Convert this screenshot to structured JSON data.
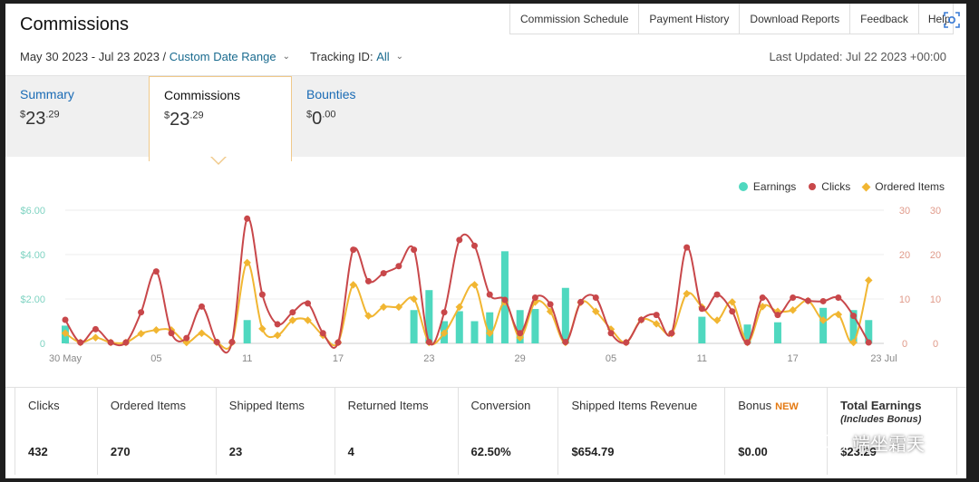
{
  "page": {
    "title": "Commissions",
    "top_tabs": [
      "Commission Schedule",
      "Payment History",
      "Download Reports",
      "Feedback",
      "Help"
    ],
    "date_range": "May 30 2023 - Jul 23 2023 /",
    "date_range_link": "Custom Date Range",
    "tracking_label": "Tracking ID:",
    "tracking_value": "All",
    "last_updated": "Last Updated: Jul 22 2023 +00:00"
  },
  "summary_tabs": [
    {
      "label": "Summary",
      "currency": "$",
      "whole": "23",
      "cents": ".29"
    },
    {
      "label": "Commissions",
      "currency": "$",
      "whole": "23",
      "cents": ".29"
    },
    {
      "label": "Bounties",
      "currency": "$",
      "whole": "0",
      "cents": ".00"
    }
  ],
  "legend": {
    "earnings": "Earnings",
    "clicks": "Clicks",
    "ordered": "Ordered Items"
  },
  "colors": {
    "earnings": "#4fd8bf",
    "clicks": "#c8474a",
    "ordered": "#f1b632",
    "link": "#1a6bb5"
  },
  "chart_data": {
    "type": "line",
    "x": [
      "30 May",
      "31 May",
      "01 Jun",
      "02 Jun",
      "03 Jun",
      "04 Jun",
      "05 Jun",
      "06 Jun",
      "07 Jun",
      "08 Jun",
      "09 Jun",
      "10 Jun",
      "11 Jun",
      "12 Jun",
      "13 Jun",
      "14 Jun",
      "15 Jun",
      "16 Jun",
      "17 Jun",
      "18 Jun",
      "19 Jun",
      "20 Jun",
      "21 Jun",
      "22 Jun",
      "23 Jun",
      "24 Jun",
      "25 Jun",
      "26 Jun",
      "27 Jun",
      "28 Jun",
      "29 Jun",
      "30 Jun",
      "01 Jul",
      "02 Jul",
      "03 Jul",
      "04 Jul",
      "05 Jul",
      "06 Jul",
      "07 Jul",
      "08 Jul",
      "09 Jul",
      "10 Jul",
      "11 Jul",
      "12 Jul",
      "13 Jul",
      "14 Jul",
      "15 Jul",
      "16 Jul",
      "17 Jul",
      "18 Jul",
      "19 Jul",
      "20 Jul",
      "21 Jul",
      "22 Jul",
      "23 Jul"
    ],
    "x_tick_labels": [
      "30 May",
      "05",
      "11",
      "17",
      "23",
      "29",
      "05",
      "11",
      "17",
      "23 Jul"
    ],
    "y_left_ticks": [
      "$6.00",
      "$4.00",
      "$2.00",
      "0"
    ],
    "y_right_ticks": [
      "30",
      "20",
      "10",
      "0"
    ],
    "y_left_range": [
      0,
      6
    ],
    "y_right_range": [
      0,
      30
    ],
    "series": [
      {
        "name": "Earnings",
        "axis": "left",
        "type": "bar",
        "values": [
          0.8,
          0,
          0,
          0,
          0,
          0,
          0,
          0,
          0,
          0,
          0,
          0,
          1.05,
          0,
          0,
          0,
          0,
          0,
          0,
          0,
          0,
          0,
          0,
          1.5,
          2.4,
          1.0,
          1.45,
          1.0,
          1.4,
          4.15,
          1.5,
          1.55,
          0,
          2.5,
          0,
          0,
          0,
          0,
          0,
          0,
          0,
          0,
          1.2,
          0,
          0,
          0.85,
          0,
          0.95,
          0,
          0,
          1.6,
          0,
          1.5,
          1.05,
          0
        ]
      },
      {
        "name": "Clicks",
        "axis": "right",
        "type": "line",
        "values": [
          5.3,
          0.2,
          3.2,
          0.2,
          0.2,
          7.0,
          16.2,
          2.3,
          1.2,
          8.3,
          0.3,
          0.3,
          28.1,
          11.0,
          4.3,
          7.0,
          9.0,
          2.3,
          0.2,
          21.1,
          14.0,
          15.8,
          17.4,
          21.1,
          0.3,
          7.0,
          23.3,
          22.0,
          11.0,
          9.8,
          2.3,
          10.3,
          8.8,
          0.3,
          9.3,
          10.3,
          2.3,
          0.2,
          5.3,
          6.4,
          2.3,
          21.6,
          7.8,
          11.0,
          7.2,
          0.2,
          10.3,
          6.4,
          10.3,
          9.6,
          9.5,
          10.3,
          6.2,
          0.2
        ]
      },
      {
        "name": "Ordered Items",
        "axis": "right",
        "type": "line",
        "values": [
          2.3,
          0.2,
          1.3,
          0.2,
          0.2,
          2.2,
          3.0,
          3.0,
          0.2,
          2.3,
          0.2,
          0.2,
          18.2,
          3.3,
          1.8,
          5.2,
          5.2,
          1.8,
          0.2,
          13.2,
          6.2,
          8.2,
          8.2,
          10.0,
          0.2,
          2.3,
          8.2,
          13.2,
          2.3,
          9.3,
          1.3,
          9.3,
          7.2,
          0.2,
          9.2,
          7.2,
          3.2,
          0.2,
          5.3,
          4.4,
          2.2,
          11.2,
          8.2,
          5.2,
          9.3,
          0.2,
          8.3,
          7.2,
          7.5,
          9.6,
          5.2,
          6.5,
          0.2,
          14.2
        ]
      }
    ]
  },
  "metrics": [
    {
      "label": "Clicks",
      "value": "432"
    },
    {
      "label": "Ordered Items",
      "value": "270"
    },
    {
      "label": "Shipped Items",
      "value": "23"
    },
    {
      "label": "Returned Items",
      "value": "4"
    },
    {
      "label": "Conversion",
      "value": "62.50%"
    },
    {
      "label": "Shipped Items Revenue",
      "value": "$654.79"
    },
    {
      "label": "Bonus",
      "badge": "NEW",
      "value": "$0.00"
    },
    {
      "label": "Total Earnings",
      "sub": "(Includes Bonus)",
      "value": "$23.29"
    }
  ],
  "watermark": "端坐霜天"
}
